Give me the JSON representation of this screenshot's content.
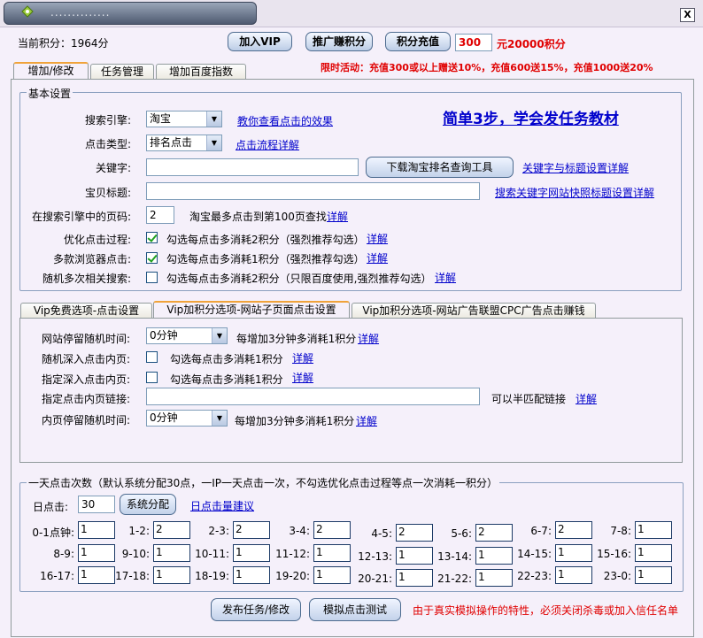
{
  "window": {
    "title": "..............",
    "close_label": "X"
  },
  "top": {
    "points_label": "当前积分：1964分",
    "join_vip": "加入VIP",
    "promote": "推广赚积分",
    "recharge": "积分充值",
    "recharge_amount": "300",
    "recharge_result": "元20000积分",
    "promo_text": "限时活动：充值300或以上赠送10%，充值600送15%，充值1000送20%"
  },
  "main_tabs": [
    "增加/修改",
    "任务管理",
    "增加百度指数"
  ],
  "basic": {
    "group_title": "基本设置",
    "tutorial_link": "简单3步，学会发任务教材",
    "engine_label": "搜索引擎:",
    "engine_value": "淘宝",
    "engine_link": "教你查看点击的效果",
    "click_type_label": "点击类型:",
    "click_type_value": "排名点击",
    "click_type_link": "点击流程详解",
    "keyword_label": "关键字:",
    "keyword_value": "",
    "download_tool": "下载淘宝排名查询工具",
    "keyword_link": "关键字与标题设置详解",
    "item_title_label": "宝贝标题:",
    "item_title_value": "",
    "item_title_link": "搜索关键字网站快照标题设置详解",
    "page_label": "在搜索引擎中的页码:",
    "page_value": "2",
    "page_note": "淘宝最多点击到第100页查找",
    "page_link": "详解",
    "optimize_label": "优化点击过程:",
    "optimize_text": "勾选每点击多消耗2积分（强烈推荐勾选）",
    "optimize_link": "详解",
    "optimize_checked": true,
    "browser_label": "多款浏览器点击:",
    "browser_text": "勾选每点击多消耗1积分（强烈推荐勾选）",
    "browser_link": "详解",
    "browser_checked": true,
    "random_label": "随机多次相关搜索:",
    "random_text": "勾选每点击多消耗2积分（只限百度使用,强烈推荐勾选）",
    "random_link": "详解",
    "random_checked": false
  },
  "sub_tabs": [
    "Vip免费选项-点击设置",
    "Vip加积分选项-网站子页面点击设置",
    "Vip加积分选项-网站广告联盟CPC广告点击赚钱"
  ],
  "sub": {
    "stay_label": "网站停留随机时间:",
    "stay_value": "0分钟",
    "stay_note": "每增加3分钟多消耗1积分",
    "stay_link": "详解",
    "deep_label": "随机深入点击内页:",
    "deep_text": "勾选每点击多消耗1积分",
    "deep_link": "详解",
    "assign_label": "指定深入点击内页:",
    "assign_text": "勾选每点击多消耗1积分",
    "assign_link": "详解",
    "link_label": "指定点击内页链接:",
    "link_value": "",
    "link_note": "可以半匹配链接",
    "link_link": "详解",
    "inner_label": "内页停留随机时间:",
    "inner_value": "0分钟",
    "inner_note": "每增加3分钟多消耗1积分",
    "inner_link": "详解"
  },
  "daily": {
    "group_title": "一天点击次数（默认系统分配30点，一IP一天点击一次，不勾选优化点击过程等点一次消耗一积分）",
    "clicks_label": "日点击:",
    "clicks_value": "30",
    "assign_button": "系统分配",
    "advice_link": "日点击量建议",
    "hours": [
      {
        "label": "0-1点钟:",
        "value": "1"
      },
      {
        "label": "1-2:",
        "value": "2"
      },
      {
        "label": "2-3:",
        "value": "2"
      },
      {
        "label": "3-4:",
        "value": "2"
      },
      {
        "label": "4-5:",
        "value": "2"
      },
      {
        "label": "5-6:",
        "value": "2"
      },
      {
        "label": "6-7:",
        "value": "2"
      },
      {
        "label": "7-8:",
        "value": "1"
      },
      {
        "label": "8-9:",
        "value": "1"
      },
      {
        "label": "9-10:",
        "value": "1"
      },
      {
        "label": "10-11:",
        "value": "1"
      },
      {
        "label": "11-12:",
        "value": "1"
      },
      {
        "label": "12-13:",
        "value": "1"
      },
      {
        "label": "13-14:",
        "value": "1"
      },
      {
        "label": "14-15:",
        "value": "1"
      },
      {
        "label": "15-16:",
        "value": "1"
      },
      {
        "label": "16-17:",
        "value": "1"
      },
      {
        "label": "17-18:",
        "value": "1"
      },
      {
        "label": "18-19:",
        "value": "1"
      },
      {
        "label": "19-20:",
        "value": "1"
      },
      {
        "label": "20-21:",
        "value": "1"
      },
      {
        "label": "21-22:",
        "value": "1"
      },
      {
        "label": "22-23:",
        "value": "1"
      },
      {
        "label": "23-0:",
        "value": "1"
      }
    ]
  },
  "bottom": {
    "publish": "发布任务/修改",
    "simulate": "模拟点击测试",
    "warning": "由于真实模拟操作的特性，必须关闭杀毒或加入信任名单"
  },
  "colors": {
    "promo_red": "#e00000",
    "link_blue": "#0000cc",
    "active_tab_accent": "#f0a33a"
  }
}
